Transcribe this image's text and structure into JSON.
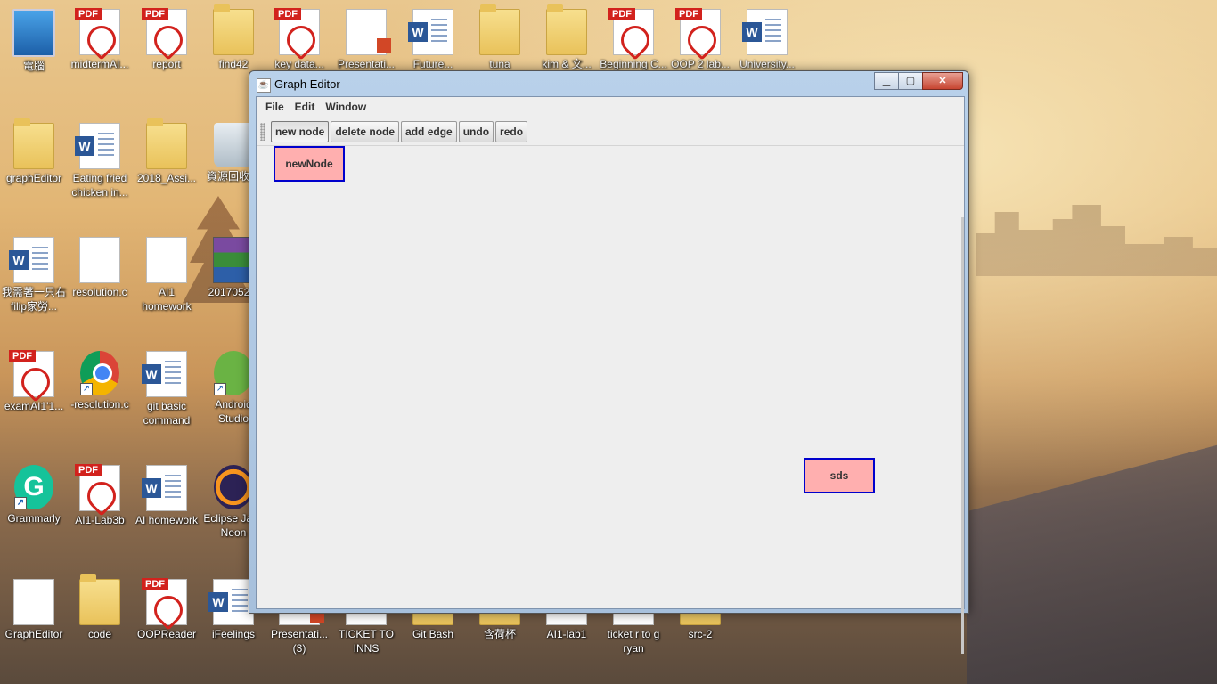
{
  "desktop": {
    "icons": [
      {
        "label": "電腦",
        "type": "pc"
      },
      {
        "label": "midtermAI...",
        "type": "pdf"
      },
      {
        "label": "report",
        "type": "pdf"
      },
      {
        "label": "find42",
        "type": "folder"
      },
      {
        "label": "key data...",
        "type": "pdf"
      },
      {
        "label": "Presentati...",
        "type": "ppt"
      },
      {
        "label": "Future...",
        "type": "word"
      },
      {
        "label": "tuna",
        "type": "folder"
      },
      {
        "label": "kim & 文...",
        "type": "folder"
      },
      {
        "label": "Beginning C...",
        "type": "pdf"
      },
      {
        "label": "OOP 2 lab...",
        "type": "pdf"
      },
      {
        "label": "University...",
        "type": "word"
      },
      {
        "label": "graphEditor",
        "type": "folder"
      },
      {
        "label": "Eating fried chicken in...",
        "type": "word"
      },
      {
        "label": "2018_Assi...",
        "type": "folder"
      },
      {
        "label": "資源回收筒",
        "type": "recycle"
      },
      {
        "label": "我需著一只右filip家勞...",
        "type": "word"
      },
      {
        "label": "resolution.c",
        "type": "blank"
      },
      {
        "label": "AI1 homework",
        "type": "blank"
      },
      {
        "label": "2017052...",
        "type": "rar"
      },
      {
        "label": "examAI1'1...",
        "type": "pdf"
      },
      {
        "label": "-resolution.c",
        "type": "chrome"
      },
      {
        "label": "git basic command",
        "type": "word"
      },
      {
        "label": "Android Studio",
        "type": "android"
      },
      {
        "label": "Grammarly",
        "type": "grammarly"
      },
      {
        "label": "AI1-Lab3b",
        "type": "pdf"
      },
      {
        "label": "AI homework",
        "type": "word"
      },
      {
        "label": "Eclipse Java Neon",
        "type": "eclipse"
      },
      {
        "label": "GraphEditor",
        "type": "blank"
      },
      {
        "label": "code",
        "type": "folder"
      },
      {
        "label": "OOPReader",
        "type": "pdf"
      },
      {
        "label": "iFeelings",
        "type": "word"
      },
      {
        "label": "Presentati... (3)",
        "type": "ppt"
      },
      {
        "label": "TICKET TO INNS",
        "type": "pdf"
      },
      {
        "label": "Git Bash",
        "type": "folder"
      },
      {
        "label": "含荷杯",
        "type": "folder"
      },
      {
        "label": "AI1-lab1",
        "type": "pdf"
      },
      {
        "label": "ticket r to g ryan",
        "type": "pdf"
      },
      {
        "label": "src-2",
        "type": "folder"
      }
    ]
  },
  "window": {
    "title": "Graph Editor",
    "app_icon": "java-icon",
    "controls": {
      "minimize": "▁",
      "maximize": "▢",
      "close": "✕"
    },
    "menu": [
      "File",
      "Edit",
      "Window"
    ],
    "toolbar": [
      "new node",
      "delete node",
      "add edge",
      "undo",
      "redo"
    ],
    "pressed_tool": "new node",
    "nodes": [
      {
        "label": "newNode"
      },
      {
        "label": "sds"
      }
    ]
  },
  "colors": {
    "node_fill": "#ffafaf",
    "node_border": "#0000cc",
    "canvas": "#eeeeee"
  }
}
